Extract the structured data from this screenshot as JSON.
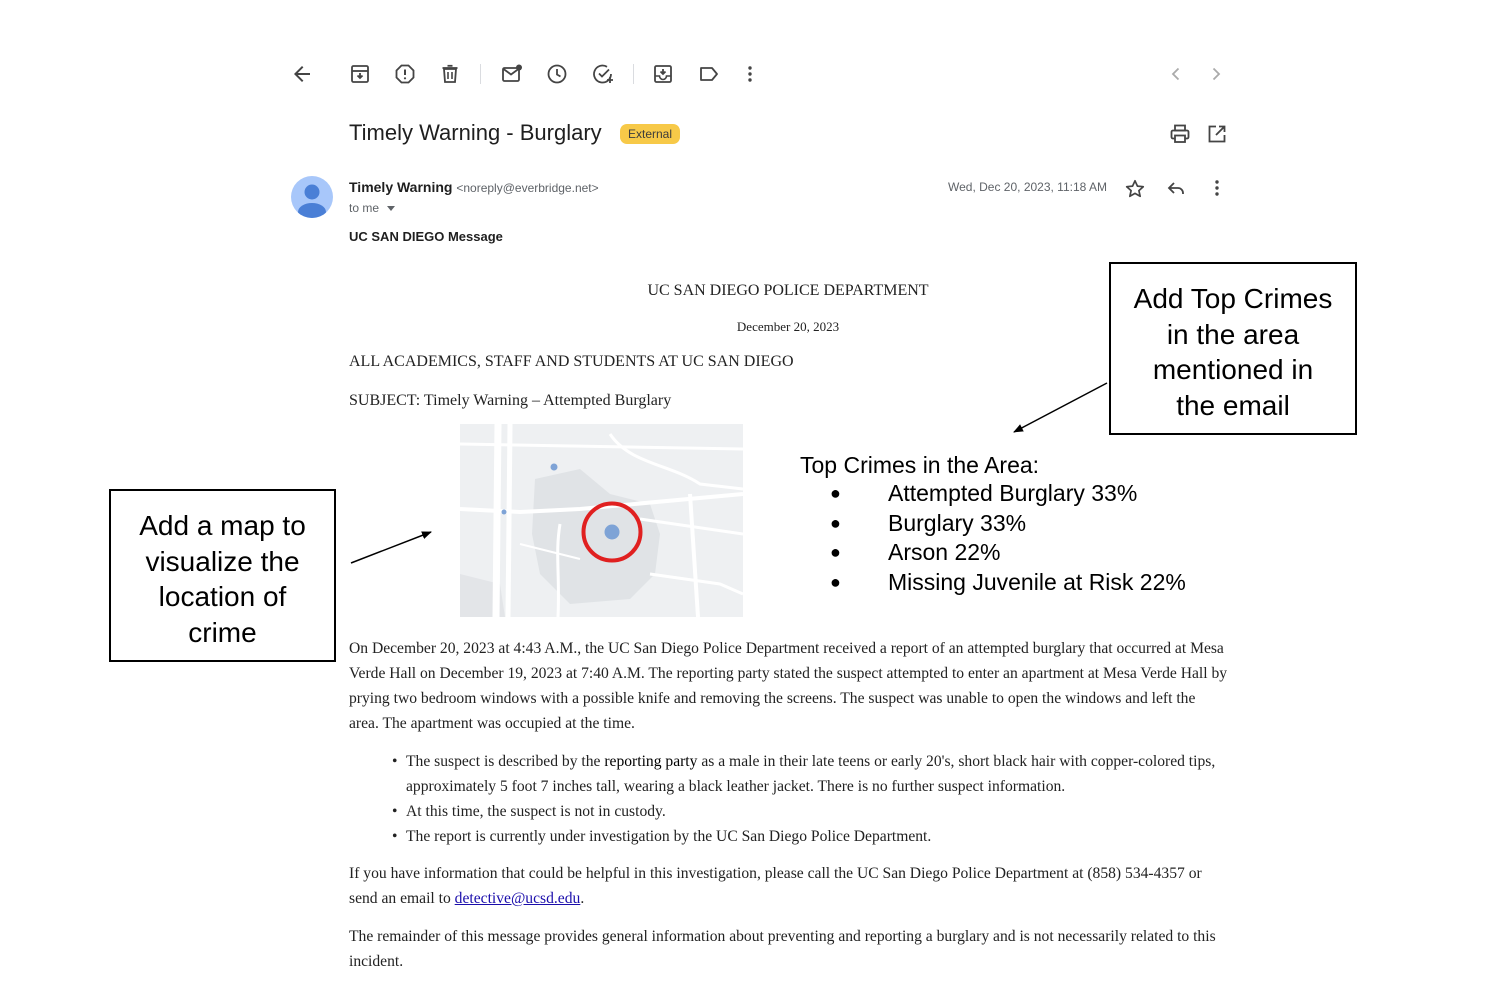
{
  "toolbar": {
    "icons": [
      "back-arrow-icon",
      "archive-icon",
      "report-spam-icon",
      "delete-icon",
      "mark-unread-icon",
      "snooze-icon",
      "add-task-icon",
      "move-to-icon",
      "label-icon",
      "more-vert-icon",
      "newer-chevron-icon",
      "older-chevron-icon"
    ]
  },
  "email": {
    "subject": "Timely Warning - Burglary",
    "badge": "External",
    "sender_name": "Timely Warning",
    "sender_email": "<noreply@everbridge.net>",
    "to": "to me",
    "date": "Wed, Dec 20, 2023, 11:18 AM",
    "header_label": "UC SAN DIEGO Message"
  },
  "body": {
    "department": "UC SAN DIEGO POLICE DEPARTMENT",
    "date": "December 20, 2023",
    "to_line": "ALL ACADEMICS, STAFF AND STUDENTS AT UC SAN DIEGO",
    "subject_line": "SUBJECT: Timely Warning – Attempted Burglary",
    "paragraph1": "On December 20, 2023 at 4:43 A.M., the UC San Diego Police Department received a report of an attempted burglary that occurred at Mesa Verde Hall on December 19, 2023 at 7:40 A.M. The reporting party stated the suspect attempted to enter an apartment at Mesa Verde Hall by prying two bedroom windows with a possible knife and removing the screens. The suspect was unable to open the windows and left the area. The apartment was occupied at the time.",
    "bullet1_a": "The suspect is described by the ",
    "bullet1_b": "reporting party",
    "bullet1_c": " as a male in their late teens or early 20's, short black hair with copper-colored tips, approximately 5 foot 7 inches tall, wearing a black leather jacket. There is no further suspect information.",
    "bullet2": "At this time, the suspect is not in custody.",
    "bullet3": "The report is currently under investigation by the UC San Diego Police Department.",
    "paragraph2_a": "If you have information that could be helpful in this investigation, please call the UC San Diego Police Department at (858) 534-4357 or send an email to ",
    "paragraph2_link": "detective@ucsd.edu",
    "paragraph2_b": ".",
    "paragraph3": "The remainder of this message provides general information about preventing and reporting a burglary and is not necessarily related to this incident."
  },
  "top_crimes": {
    "title": "Top Crimes in the Area:",
    "bullet": "●",
    "items": [
      "Attempted Burglary 33%",
      "Burglary 33%",
      "Arson 22%",
      "Missing Juvenile at Risk 22%"
    ]
  },
  "callouts": {
    "right": [
      "Add Top Crimes",
      "in the area",
      "mentioned in",
      "the email"
    ],
    "left": [
      "Add a map to",
      "visualize the",
      "location of",
      "crime"
    ]
  },
  "colors": {
    "badge": "#f7c948",
    "avatar": "#a8c7fa",
    "map_marker_ring": "#e02020",
    "map_marker_dot": "#7ea3d6",
    "link": "#1a0dab"
  }
}
